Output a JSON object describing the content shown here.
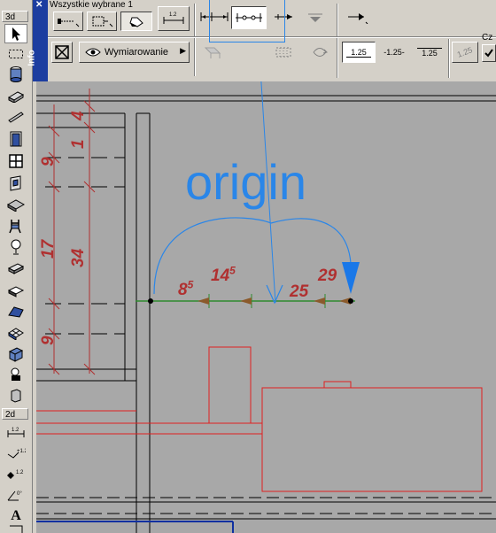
{
  "toolbox": {
    "label_3d": "3d",
    "label_2d": "2d",
    "tools_3d": [
      "pointer-icon",
      "marquee-icon",
      "cylinder-icon",
      "wall-icon",
      "beam-icon",
      "door-icon",
      "window-icon",
      "skylight-icon",
      "roof-icon",
      "stair-icon",
      "object-icon",
      "lamp-icon",
      "slab-icon",
      "zone-icon",
      "roof-plane-icon",
      "mesh-icon",
      "curtain-wall-icon",
      "camera-icon",
      "morph-icon"
    ],
    "tools_2d": [
      "linear-dimension-icon",
      "level-dimension-icon",
      "elevation-dimension-icon",
      "angle-dimension-icon",
      "text-icon",
      "label-icon"
    ],
    "text_tool_glyph": "A"
  },
  "info_box": {
    "strip_label": "Info",
    "selection_status": "Wszystkie wybrane 1",
    "layer_name": "Wymiarowanie",
    "dim_value_a": "1.25",
    "dim_value_b": "-1.25-",
    "dim_value_c": "1.25",
    "dim_value_d": "1.25",
    "cut_label": "Cz"
  },
  "drawing": {
    "annotation": "origin",
    "horizontal_dims": [
      {
        "main": "8",
        "sup": "5"
      },
      {
        "main": "14",
        "sup": "5"
      },
      {
        "main": "25",
        "sup": ""
      },
      {
        "main": "29",
        "sup": ""
      }
    ],
    "vertical_dims": [
      "4",
      "1",
      "9",
      "17",
      "34",
      "9"
    ],
    "colors": {
      "canvas": "#a8a8a8",
      "dimension_red": "#b03030",
      "dimension_green": "#2e8b2e",
      "annotation_blue": "#2a86e8",
      "element_red": "#e02020",
      "line_black": "#000000"
    }
  }
}
